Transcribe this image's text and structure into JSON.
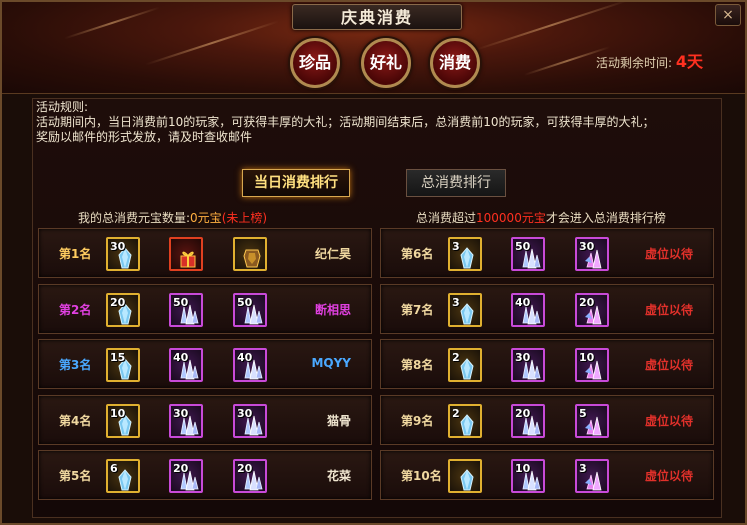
{
  "window": {
    "title": "庆典消费",
    "close_label": "×"
  },
  "tabs": [
    {
      "label": "珍品"
    },
    {
      "label": "好礼"
    },
    {
      "label": "消费"
    }
  ],
  "timer": {
    "label": "活动剩余时间:",
    "value": "4天"
  },
  "rules": {
    "title": "活动规则:",
    "line1": "活动期间内，当日消费前10的玩家，可获得丰厚的大礼；活动期间结束后，总消费前10的玩家，可获得丰厚的大礼；",
    "line2": "奖励以邮件的形式发放，请及时查收邮件"
  },
  "buttons": {
    "daily": "当日消费排行",
    "total": "总消费排行"
  },
  "my_total": {
    "prefix": "我的总消费元宝数量:",
    "amount": "0元宝",
    "status": "(未上榜)"
  },
  "threshold": {
    "prefix": "总消费超过",
    "amount": "100000元宝",
    "suffix": "才会进入总消费排行榜"
  },
  "colors": {
    "gold": "#ffb040",
    "red": "#ff3020",
    "magenta": "#e040e0",
    "blue": "#4aa8ff",
    "rank_default": "#f0d8a0"
  },
  "left_ranks": [
    {
      "rank": "第1名",
      "rank_color": "#ffcc60",
      "name": "纪仁昊",
      "name_color": "#f0d8a0",
      "items": [
        {
          "count": "30",
          "border": "gold",
          "icon": "blue-crystal-icon"
        },
        {
          "count": "",
          "border": "red",
          "icon": "gift-icon"
        },
        {
          "count": "",
          "border": "gold",
          "icon": "armor-icon"
        }
      ]
    },
    {
      "rank": "第2名",
      "rank_color": "#e040e0",
      "name": "断相思",
      "name_color": "#e040e0",
      "items": [
        {
          "count": "20",
          "border": "gold",
          "icon": "blue-crystal-icon"
        },
        {
          "count": "50",
          "border": "purple",
          "icon": "crystal-cluster-icon"
        },
        {
          "count": "50",
          "border": "purple",
          "icon": "crystal-cluster-icon"
        }
      ]
    },
    {
      "rank": "第3名",
      "rank_color": "#4aa8ff",
      "name": "MQYY",
      "name_color": "#4aa8ff",
      "items": [
        {
          "count": "15",
          "border": "gold",
          "icon": "blue-crystal-icon"
        },
        {
          "count": "40",
          "border": "purple",
          "icon": "crystal-cluster-icon"
        },
        {
          "count": "40",
          "border": "purple",
          "icon": "crystal-cluster-icon"
        }
      ]
    },
    {
      "rank": "第4名",
      "rank_color": "#f0d8a0",
      "name": "猫骨",
      "name_color": "#f0e6d0",
      "items": [
        {
          "count": "10",
          "border": "gold",
          "icon": "blue-crystal-icon"
        },
        {
          "count": "30",
          "border": "purple",
          "icon": "crystal-cluster-icon"
        },
        {
          "count": "30",
          "border": "purple",
          "icon": "crystal-cluster-icon"
        }
      ]
    },
    {
      "rank": "第5名",
      "rank_color": "#f0d8a0",
      "name": "花菜",
      "name_color": "#f0e6d0",
      "items": [
        {
          "count": "6",
          "border": "gold",
          "icon": "blue-crystal-icon"
        },
        {
          "count": "20",
          "border": "purple",
          "icon": "crystal-cluster-icon"
        },
        {
          "count": "20",
          "border": "purple",
          "icon": "crystal-cluster-icon"
        }
      ]
    }
  ],
  "right_ranks": [
    {
      "rank": "第6名",
      "rank_color": "#f0d8a0",
      "name": "虚位以待",
      "name_color": "#e0302a",
      "items": [
        {
          "count": "3",
          "border": "gold",
          "icon": "blue-crystal-icon"
        },
        {
          "count": "50",
          "border": "purple",
          "icon": "crystal-cluster-icon"
        },
        {
          "count": "30",
          "border": "purple",
          "icon": "pink-crystal-icon"
        }
      ]
    },
    {
      "rank": "第7名",
      "rank_color": "#f0d8a0",
      "name": "虚位以待",
      "name_color": "#e0302a",
      "items": [
        {
          "count": "3",
          "border": "gold",
          "icon": "blue-crystal-icon"
        },
        {
          "count": "40",
          "border": "purple",
          "icon": "crystal-cluster-icon"
        },
        {
          "count": "20",
          "border": "purple",
          "icon": "pink-crystal-icon"
        }
      ]
    },
    {
      "rank": "第8名",
      "rank_color": "#f0d8a0",
      "name": "虚位以待",
      "name_color": "#e0302a",
      "items": [
        {
          "count": "2",
          "border": "gold",
          "icon": "blue-crystal-icon"
        },
        {
          "count": "30",
          "border": "purple",
          "icon": "crystal-cluster-icon"
        },
        {
          "count": "10",
          "border": "purple",
          "icon": "pink-crystal-icon"
        }
      ]
    },
    {
      "rank": "第9名",
      "rank_color": "#f0d8a0",
      "name": "虚位以待",
      "name_color": "#e0302a",
      "items": [
        {
          "count": "2",
          "border": "gold",
          "icon": "blue-crystal-icon"
        },
        {
          "count": "20",
          "border": "purple",
          "icon": "crystal-cluster-icon"
        },
        {
          "count": "5",
          "border": "purple",
          "icon": "pink-crystal-icon"
        }
      ]
    },
    {
      "rank": "第10名",
      "rank_color": "#f0d8a0",
      "name": "虚位以待",
      "name_color": "#e0302a",
      "items": [
        {
          "count": "",
          "border": "gold",
          "icon": "blue-crystal-icon"
        },
        {
          "count": "10",
          "border": "purple",
          "icon": "crystal-cluster-icon"
        },
        {
          "count": "3",
          "border": "purple",
          "icon": "pink-crystal-icon"
        }
      ]
    }
  ]
}
